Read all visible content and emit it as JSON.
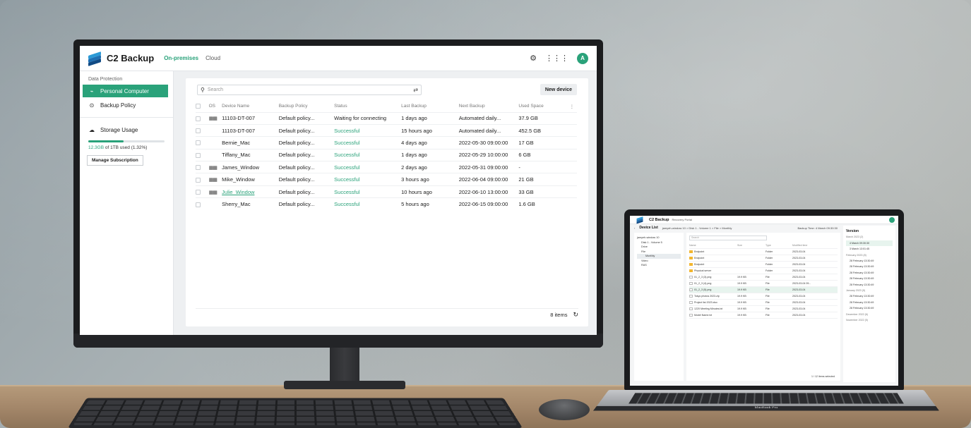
{
  "app": {
    "brand": "C2 Backup",
    "tabs": [
      "On-premises",
      "Cloud"
    ],
    "avatar_initial": "A",
    "accent_color": "#2aa27a"
  },
  "sidebar": {
    "section_title": "Data Protection",
    "items": [
      {
        "label": "Personal Computer",
        "icon": "computer-icon",
        "active": true
      },
      {
        "label": "Backup Policy",
        "icon": "policy-icon",
        "active": false
      }
    ],
    "storage": {
      "label": "Storage Usage",
      "used": "12.3GB",
      "of_text": "of 1TB used (1.32%)",
      "percent": 1.32,
      "manage_label": "Manage Subscription"
    }
  },
  "main": {
    "search_placeholder": "Search",
    "new_device_label": "New device",
    "columns": [
      "OS",
      "Device Name",
      "Backup Policy",
      "Status",
      "Last Backup",
      "Next Backup",
      "Used Space"
    ],
    "rows": [
      {
        "os": "windows",
        "device": "11103-DT-007",
        "policy": "Default policy...",
        "status": "Waiting for connecting",
        "last": "1 days ago",
        "next": "Automated daily...",
        "used": "37.9 GB",
        "link": false
      },
      {
        "os": "mac",
        "device": "11103-DT-007",
        "policy": "Default policy...",
        "status": "Successful",
        "last": "15 hours ago",
        "next": "Automated daily...",
        "used": "452.5 GB",
        "link": false
      },
      {
        "os": "mac",
        "device": "Bernie_Mac",
        "policy": "Default policy...",
        "status": "Successful",
        "last": "4 days ago",
        "next": "2022-05-30 09:00:00",
        "used": "17 GB",
        "link": false
      },
      {
        "os": "mac",
        "device": "Tiffany_Mac",
        "policy": "Default policy...",
        "status": "Successful",
        "last": "1 days ago",
        "next": "2022-05-29 10:00:00",
        "used": "6 GB",
        "link": false
      },
      {
        "os": "windows",
        "device": "James_Window",
        "policy": "Default policy...",
        "status": "Successful",
        "last": "2 days ago",
        "next": "2022-05-31 09:00:00",
        "used": "-",
        "link": false
      },
      {
        "os": "windows",
        "device": "Mike_Window",
        "policy": "Default policy...",
        "status": "Successful",
        "last": "3 hours ago",
        "next": "2022-06-04 09:00:00",
        "used": "21 GB",
        "link": false
      },
      {
        "os": "windows",
        "device": "Julie_Window",
        "policy": "Default policy...",
        "status": "Successful",
        "last": "10 hours ago",
        "next": "2022-06-10 13:00:00",
        "used": "33 GB",
        "link": true
      },
      {
        "os": "mac",
        "device": "Sherry_Mac",
        "policy": "Default policy...",
        "status": "Successful",
        "last": "5 hours ago",
        "next": "2022-06-15 09:00:00",
        "used": "1.6 GB",
        "link": false
      }
    ],
    "item_count": "8 items"
  },
  "laptop": {
    "brand": "C2 Backup",
    "portal": "Recovery Portal",
    "back_label": "Device List",
    "breadcrumb": "jamyeh-window 10 > Disk 1 - Volume 1 > File > Monthly",
    "backup_time": "Backup Time: 4 March 09:30:30",
    "tree": [
      "jamyeh-window 10",
      "Disk 1 - Volume 5",
      "Drive",
      "File",
      "Monthly",
      "Video",
      "RAS"
    ],
    "search_placeholder": "Search",
    "file_columns": [
      "Name",
      "Size",
      "Type",
      "Modified time"
    ],
    "files": [
      {
        "name": "Endpoint",
        "size": "",
        "type": "Folder",
        "time": "2023-03-04",
        "folder": true
      },
      {
        "name": "Endpoint",
        "size": "",
        "type": "Folder",
        "time": "2023-03-04",
        "folder": true
      },
      {
        "name": "Endpoint",
        "size": "",
        "type": "Folder",
        "time": "2023-03-04",
        "folder": true
      },
      {
        "name": "Physical server",
        "size": "",
        "type": "Folder",
        "time": "2023-03-04",
        "folder": true
      },
      {
        "name": "01_2_3 (3).png",
        "size": "19.9 KB",
        "type": "File",
        "time": "2023-03-04",
        "folder": false
      },
      {
        "name": "01_2_3 (4).png",
        "size": "19.9 KB",
        "type": "File",
        "time": "2023-03-04 09...",
        "folder": false
      },
      {
        "name": "01_2_3 (5).png",
        "size": "19.9 KB",
        "type": "File",
        "time": "2023-03-04",
        "folder": false
      },
      {
        "name": "Tokyo photos 2023.zip",
        "size": "19.9 KB",
        "type": "File",
        "time": "2023-03-04",
        "folder": false
      },
      {
        "name": "Project list 2023.xlsx",
        "size": "19.9 KB",
        "type": "File",
        "time": "2023-03-04",
        "folder": false
      },
      {
        "name": "1220 Meeting Minutes.txt",
        "size": "19.9 KB",
        "type": "File",
        "time": "2023-03-04",
        "folder": false
      },
      {
        "name": "Model Name.txt",
        "size": "19.9 KB",
        "type": "File",
        "time": "2023-03-04",
        "folder": false
      }
    ],
    "selection": "1 / 12 items selected",
    "version_title": "Version",
    "versions": [
      {
        "group": "March 2023 (2)",
        "items": [
          "4 March 09:30:30",
          "3 March 13:01:45"
        ]
      },
      {
        "group": "February 2023 (8)",
        "items": [
          "28 February 13:30:49",
          "28 February 13:30:49",
          "28 February 13:30:49",
          "28 February 13:30:49",
          "28 February 13:30:49"
        ]
      },
      {
        "group": "January 2023 (5)",
        "items": [
          "28 February 13:30:49",
          "28 February 13:30:49",
          "28 February 13:30:49"
        ]
      },
      {
        "group": "December 2022 (6)",
        "items": []
      },
      {
        "group": "November 2022 (5)",
        "items": []
      }
    ],
    "keyboard_label": "MacBook Pro"
  }
}
